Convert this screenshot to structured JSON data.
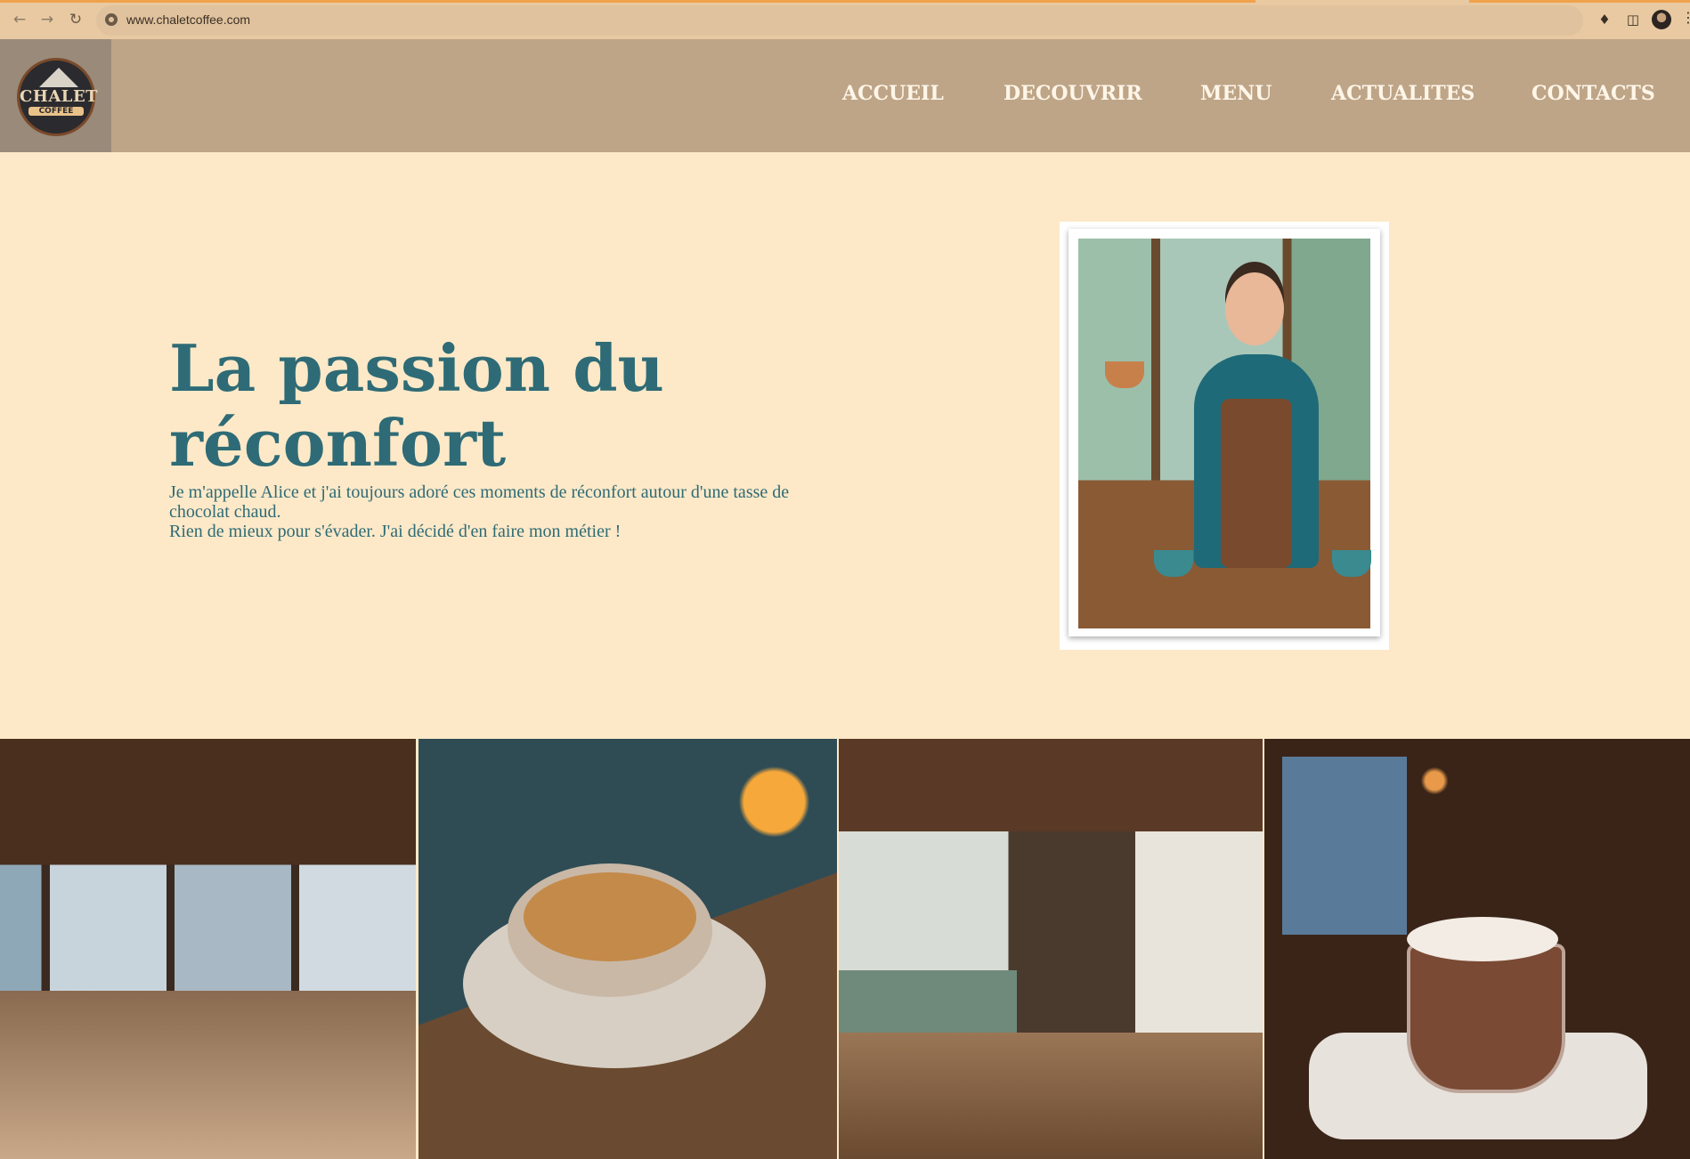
{
  "browser": {
    "url": "www.chaletcoffee.com",
    "back_icon": "arrow-left-icon",
    "forward_icon": "arrow-right-icon",
    "reload_icon": "reload-icon",
    "site_info_icon": "site-info-icon",
    "extensions_icon": "puzzle-icon",
    "sidepanel_icon": "side-panel-icon",
    "profile_icon": "avatar",
    "menu_icon": "kebab-menu-icon"
  },
  "site": {
    "logo": {
      "line1": "CHALET",
      "line2": "COFFEE"
    },
    "nav": [
      {
        "label": "ACCUEIL"
      },
      {
        "label": "DECOUVRIR"
      },
      {
        "label": "MENU"
      },
      {
        "label": "ACTUALITES"
      },
      {
        "label": "CONTACTS"
      }
    ]
  },
  "hero": {
    "title_line1": "La passion du",
    "title_line2": "réconfort",
    "text_line1": "Je m'appelle Alice et j'ai toujours adoré ces moments de réconfort autour d'une tasse de",
    "text_line2": "chocolat chaud.",
    "text_line3": "Rien de mieux pour s'évader. J'ai décidé d'en faire mon métier !"
  },
  "colors": {
    "page_bg": "#fde9c8",
    "header_bg": "#bea588",
    "title_color": "#2e6b76",
    "nav_text": "#fff6e8"
  }
}
